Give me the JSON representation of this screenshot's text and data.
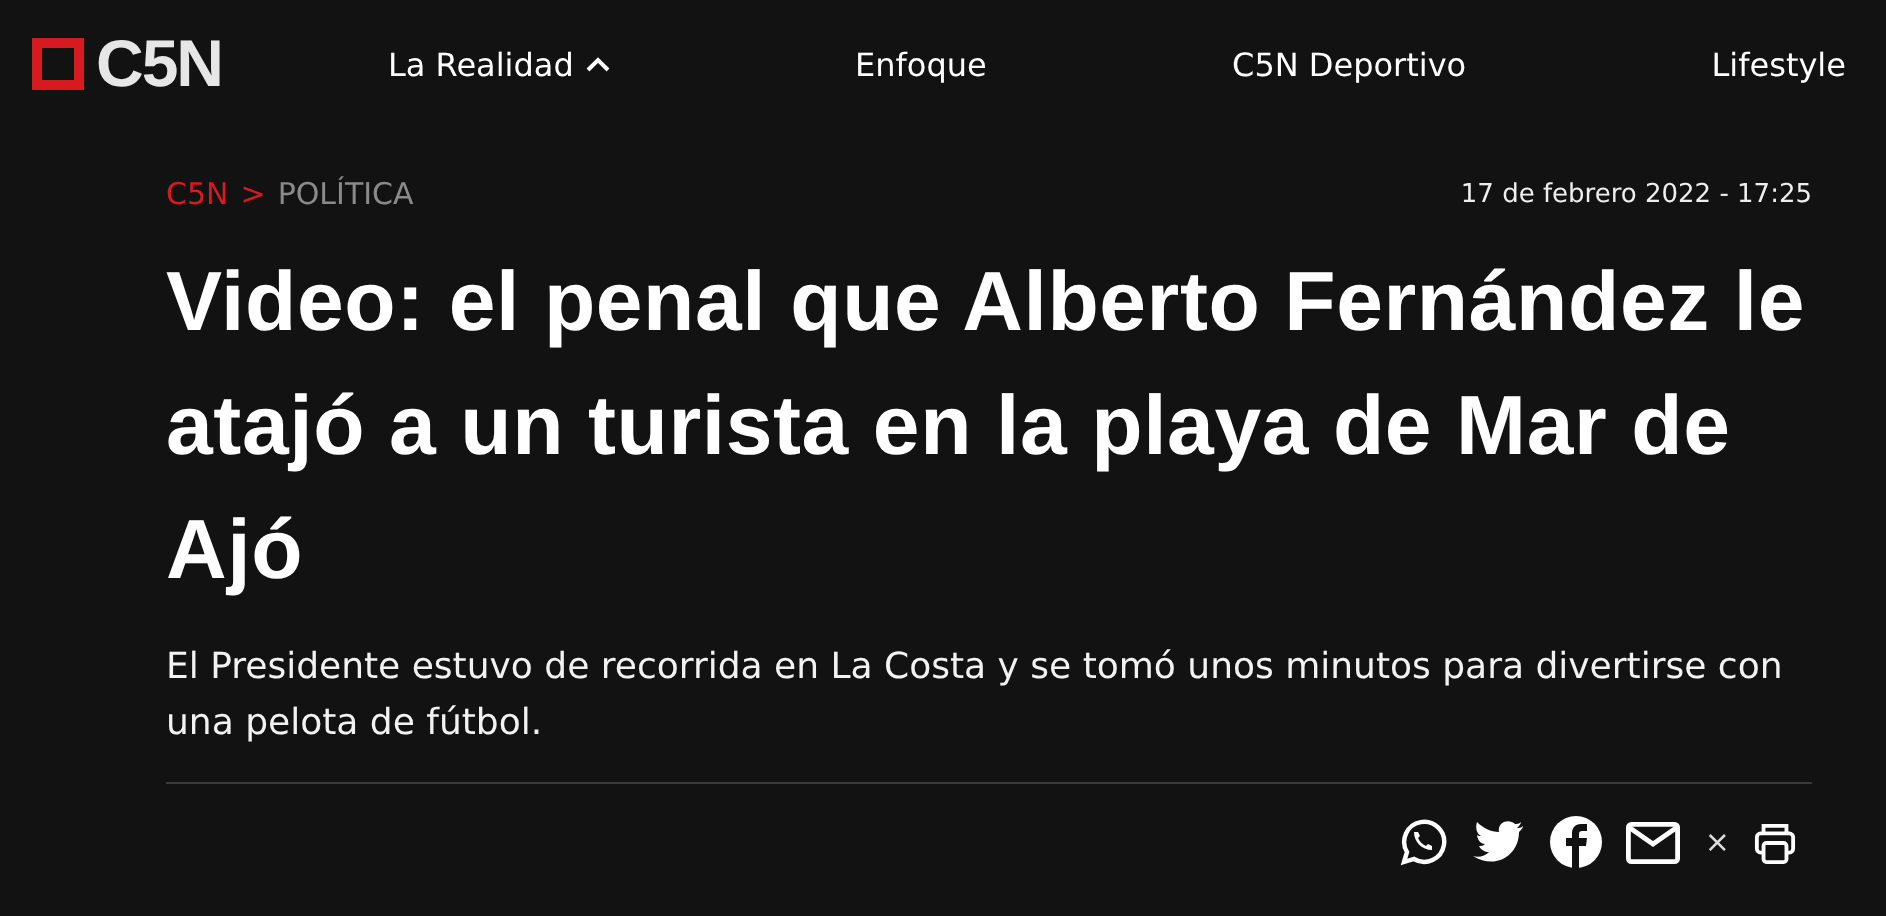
{
  "header": {
    "logo": "C5N",
    "nav": [
      {
        "label": "La Realidad",
        "expanded": true
      },
      {
        "label": "Enfoque",
        "expanded": false
      },
      {
        "label": "C5N Deportivo",
        "expanded": false
      },
      {
        "label": "Lifestyle",
        "expanded": false
      }
    ]
  },
  "breadcrumb": {
    "home": "C5N",
    "separator": ">",
    "section": "POLÍTICA"
  },
  "date": "17 de febrero 2022 - 17:25",
  "headline": "Video: el penal que Alberto Fernández le atajó a un turista en la playa de Mar de Ajó",
  "summary": "El Presidente estuvo de recorrida en La Costa y se tomó unos minutos para divertirse con una pelota de fútbol.",
  "share": [
    {
      "kind": "whatsapp"
    },
    {
      "kind": "twitter"
    },
    {
      "kind": "facebook"
    },
    {
      "kind": "email"
    },
    {
      "kind": "close",
      "text": "×"
    },
    {
      "kind": "print"
    }
  ]
}
